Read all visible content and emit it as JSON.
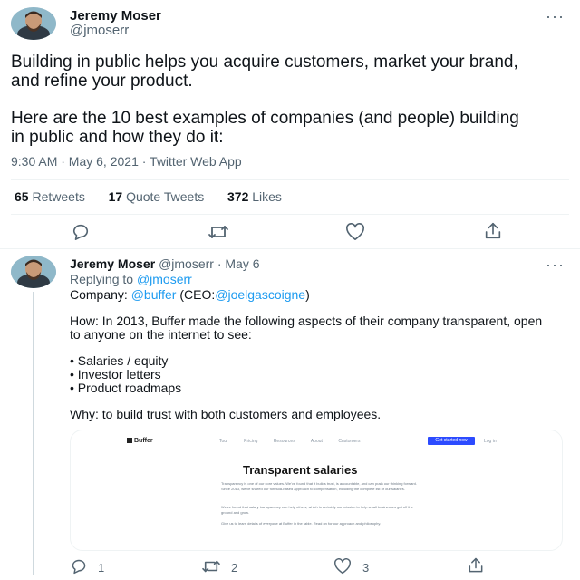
{
  "main_tweet": {
    "author_name": "Jeremy Moser",
    "author_handle": "@jmoserr",
    "paragraph1": "Building in public helps you acquire customers, market your brand, and refine your product.",
    "paragraph2": "Here are the 10 best examples of companies (and people) building in public and how they do it:",
    "timestamp": "9:30 AM · May 6, 2021 · Twitter Web App",
    "stats": {
      "retweets_count": "65",
      "retweets_label": "Retweets",
      "quotes_count": "17",
      "quotes_label": "Quote Tweets",
      "likes_count": "372",
      "likes_label": "Likes"
    },
    "actions": [
      "reply-icon",
      "retweet-icon",
      "like-icon",
      "share-icon"
    ]
  },
  "reply_tweet": {
    "author_name": "Jeremy Moser",
    "author_handle": "@jmoserr",
    "date": "· May 6",
    "replying_prefix": "Replying to",
    "replying_handle": "@jmoserr",
    "company_prefix": "Company:",
    "company_handle": "@buffer",
    "ceo_prefix": "(CEO:",
    "ceo_handle": "@joelgascoigne",
    "ceo_suffix": ")",
    "how_text": "How: In 2013, Buffer made the following aspects of their company transparent, open to anyone on the internet to see:",
    "bullets": [
      "• Salaries / equity",
      "• Investor letters",
      "• Product roadmaps"
    ],
    "why_text": "Why: to build trust with both customers and employees.",
    "actions": {
      "reply_count": "1",
      "retweet_count": "2",
      "like_count": "3"
    }
  },
  "embedded_page": {
    "logo": "Buffer",
    "nav": [
      "Tour",
      "Pricing",
      "Resources",
      "About",
      "Customers"
    ],
    "cta": "Get started now",
    "login": "Log in",
    "heading": "Transparent salaries",
    "para1": "Transparency is one of our core values. We've found that it builds trust, is accountable, and can push our thinking forward. Since 2013, we've shared our formula-based approach to compensation, including the complete list of our salaries.",
    "para2": "We've found that salary transparency can help others, which is certainly our mission to help small businesses get off the ground and grow.",
    "para3": "Give us to learn details of everyone at Buffer in the table. Read on for our approach and philosophy.",
    "accent": "#2c4bff"
  },
  "colors": {
    "text": "#0f1419",
    "secondary": "#536471",
    "link": "#1d9bf0",
    "divider": "#eff3f4"
  }
}
